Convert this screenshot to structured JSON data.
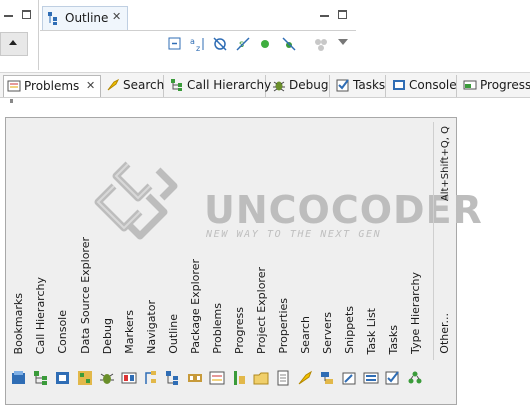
{
  "outline": {
    "tab_label": "Outline",
    "close_glyph": "✕"
  },
  "bottom_tabs": [
    {
      "label": "Problems",
      "icon": "problems-icon",
      "active": true,
      "close_glyph": "✕"
    },
    {
      "label": "Search",
      "icon": "search-icon"
    },
    {
      "label": "Call Hierarchy",
      "icon": "call-hierarchy-icon"
    },
    {
      "label": "Debug",
      "icon": "debug-icon"
    },
    {
      "label": "Tasks",
      "icon": "tasks-icon"
    },
    {
      "label": "Console",
      "icon": "console-icon"
    },
    {
      "label": "Progress",
      "icon": "progress-icon"
    }
  ],
  "views_popup": {
    "shortcut": "Alt+Shift+Q, Q",
    "views": [
      "Bookmarks",
      "Call Hierarchy",
      "Console",
      "Data Source Explorer",
      "Debug",
      "Markers",
      "Navigator",
      "Outline",
      "Package Explorer",
      "Problems",
      "Progress",
      "Project Explorer",
      "Properties",
      "Search",
      "Servers",
      "Snippets",
      "Task List",
      "Tasks",
      "Type Hierarchy",
      "Other..."
    ]
  },
  "watermark": {
    "title": "UNCOCODER",
    "subtitle": "NEW WAY TO THE NEXT GEN"
  },
  "colors": {
    "accent_blue": "#2f6db5",
    "green": "#3a9b3a",
    "popup_bg": "#efefef"
  }
}
